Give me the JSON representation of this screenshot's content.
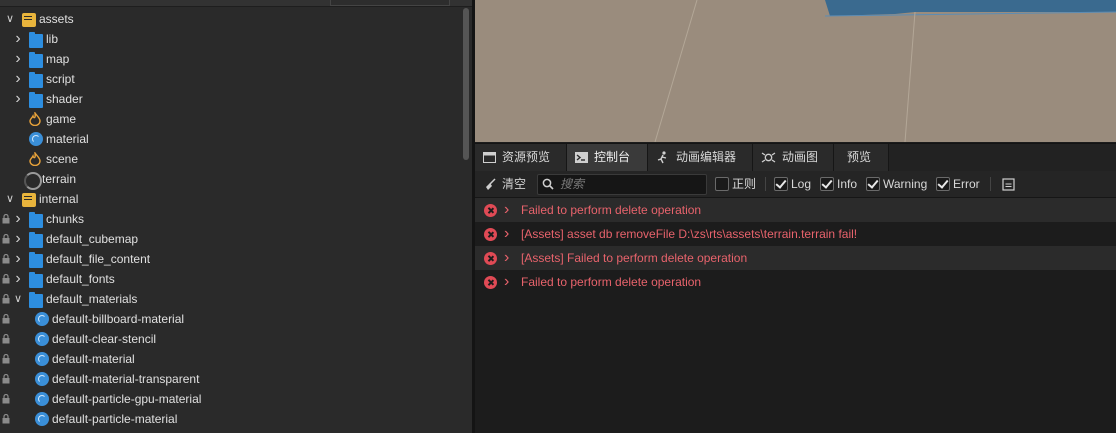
{
  "assets_tree": {
    "rows": [
      {
        "label": "assets",
        "indent": 0,
        "arrow": "down",
        "icon": "database-icon",
        "locked": false
      },
      {
        "label": "lib",
        "indent": 1,
        "arrow": "right",
        "icon": "folder-icon",
        "locked": false
      },
      {
        "label": "map",
        "indent": 1,
        "arrow": "right",
        "icon": "folder-icon",
        "locked": false
      },
      {
        "label": "script",
        "indent": 1,
        "arrow": "right",
        "icon": "folder-icon",
        "locked": false
      },
      {
        "label": "shader",
        "indent": 1,
        "arrow": "right",
        "icon": "folder-icon",
        "locked": false
      },
      {
        "label": "game",
        "indent": 1,
        "arrow": "",
        "icon": "scene-icon",
        "locked": false
      },
      {
        "label": "material",
        "indent": 1,
        "arrow": "",
        "icon": "material-icon",
        "locked": false
      },
      {
        "label": "scene",
        "indent": 1,
        "arrow": "",
        "icon": "scene-icon",
        "locked": false
      },
      {
        "label": "terrain",
        "indent": 1,
        "arrow": "",
        "icon": "terrain-icon",
        "locked": false
      },
      {
        "label": "internal",
        "indent": 0,
        "arrow": "down",
        "icon": "database-icon",
        "locked": false
      },
      {
        "label": "chunks",
        "indent": 1,
        "arrow": "right",
        "icon": "folder-icon",
        "locked": true
      },
      {
        "label": "default_cubemap",
        "indent": 1,
        "arrow": "right",
        "icon": "folder-icon",
        "locked": true
      },
      {
        "label": "default_file_content",
        "indent": 1,
        "arrow": "right",
        "icon": "folder-icon",
        "locked": true
      },
      {
        "label": "default_fonts",
        "indent": 1,
        "arrow": "right",
        "icon": "folder-icon",
        "locked": true
      },
      {
        "label": "default_materials",
        "indent": 1,
        "arrow": "down",
        "icon": "folder-icon",
        "locked": true
      },
      {
        "label": "default-billboard-material",
        "indent": 2,
        "arrow": "",
        "icon": "material-icon",
        "locked": true
      },
      {
        "label": "default-clear-stencil",
        "indent": 2,
        "arrow": "",
        "icon": "material-icon",
        "locked": true
      },
      {
        "label": "default-material",
        "indent": 2,
        "arrow": "",
        "icon": "material-icon",
        "locked": true
      },
      {
        "label": "default-material-transparent",
        "indent": 2,
        "arrow": "",
        "icon": "material-icon",
        "locked": true
      },
      {
        "label": "default-particle-gpu-material",
        "indent": 2,
        "arrow": "",
        "icon": "material-icon",
        "locked": true
      },
      {
        "label": "default-particle-material",
        "indent": 2,
        "arrow": "",
        "icon": "material-icon",
        "locked": true
      }
    ]
  },
  "tabs": [
    {
      "label": "资源预览",
      "icon": "asset-preview-icon",
      "active": false
    },
    {
      "label": "控制台",
      "icon": "console-icon",
      "active": true
    },
    {
      "label": "动画编辑器",
      "icon": "animation-editor-icon",
      "active": false
    },
    {
      "label": "动画图",
      "icon": "animation-graph-icon",
      "active": false
    },
    {
      "label": "预览",
      "icon": "",
      "active": false
    }
  ],
  "console_toolbar": {
    "clear_label": "清空",
    "search_placeholder": "搜索",
    "filters": [
      {
        "label": "正则",
        "checked": false
      },
      {
        "label": "Log",
        "checked": true
      },
      {
        "label": "Info",
        "checked": true
      },
      {
        "label": "Warning",
        "checked": true
      },
      {
        "label": "Error",
        "checked": true
      }
    ]
  },
  "console_logs": [
    {
      "message": "Failed to perform delete operation",
      "level": "error"
    },
    {
      "message": "[Assets] asset db removeFile D:\\zs\\rts\\assets\\terrain.terrain fail!",
      "level": "error"
    },
    {
      "message": "[Assets] Failed to perform delete operation",
      "level": "error"
    },
    {
      "message": "Failed to perform delete operation",
      "level": "error"
    }
  ],
  "colors": {
    "error_text": "#e8636c",
    "scene_ground": "#9a8c7d",
    "folder": "#2d8ee0"
  }
}
